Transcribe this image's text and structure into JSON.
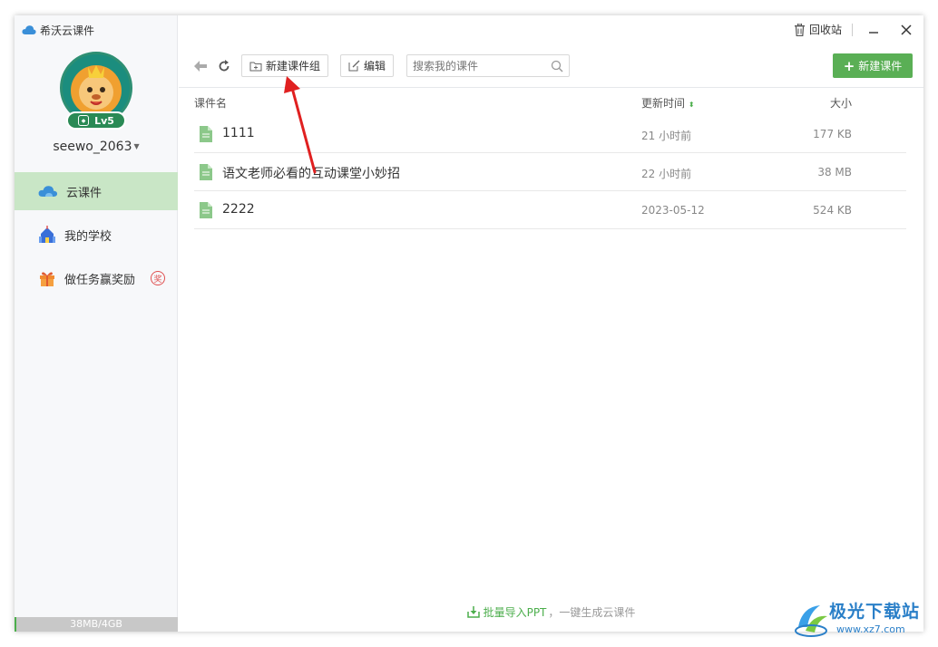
{
  "app": {
    "title": "希沃云课件"
  },
  "user": {
    "level": "Lv5",
    "username": "seewo_2063"
  },
  "sidebar": {
    "items": [
      {
        "label": "云课件",
        "icon": "cloud-icon",
        "active": true
      },
      {
        "label": "我的学校",
        "icon": "school-icon",
        "active": false
      },
      {
        "label": "做任务赢奖励",
        "icon": "gift-icon",
        "active": false,
        "badge": "奖"
      }
    ],
    "storage": {
      "label": "38MB/4GB",
      "used_fraction": 0.0093
    }
  },
  "titlebar": {
    "recycle_label": "回收站"
  },
  "toolbar": {
    "new_group_label": "新建课件组",
    "edit_label": "编辑",
    "search_placeholder": "搜索我的课件",
    "new_courseware_label": "新建课件"
  },
  "table": {
    "columns": {
      "name": "课件名",
      "time": "更新时间",
      "size": "大小"
    },
    "rows": [
      {
        "name": "1111",
        "time": "21 小时前",
        "size": "177 KB"
      },
      {
        "name": "语文老师必看的互动课堂小妙招",
        "time": "22 小时前",
        "size": "38 MB"
      },
      {
        "name": "2222",
        "time": "2023-05-12",
        "size": "524 KB"
      }
    ]
  },
  "footer": {
    "link_label": "批量导入PPT",
    "rest_label": "，一键生成云课件"
  },
  "watermark": {
    "line1": "极光下载站",
    "line2": "www.xz7.com"
  },
  "colors": {
    "accent": "#5aaf55",
    "active_nav": "#c9e6c6",
    "annotation_arrow": "#e02020"
  }
}
